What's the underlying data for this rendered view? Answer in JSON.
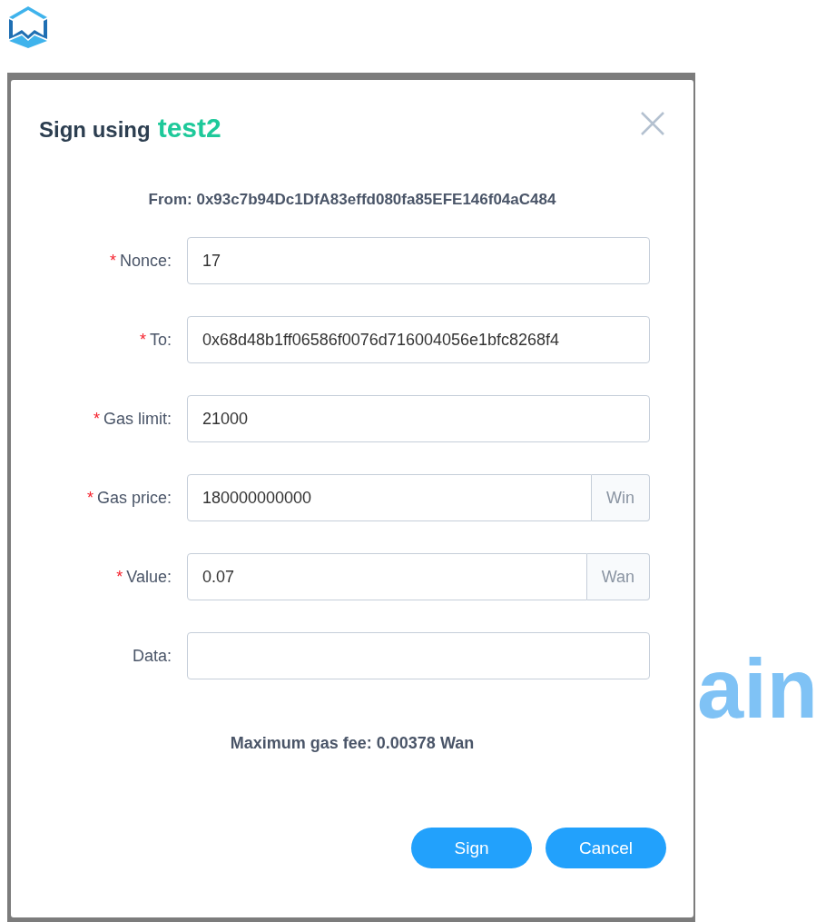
{
  "background_text": "ain",
  "dialog": {
    "title": "Sign using",
    "account": "test2",
    "from": "From: 0x93c7b94Dc1DfA83effd080fa85EFE146f04aC484",
    "required_mark": "*",
    "fields": [
      {
        "label": "Nonce:",
        "required": true,
        "value": "17"
      },
      {
        "label": "To:",
        "required": true,
        "value": "0x68d48b1ff06586f0076d716004056e1bfc8268f4"
      },
      {
        "label": "Gas limit:",
        "required": true,
        "value": "21000"
      },
      {
        "label": "Gas price:",
        "required": true,
        "value": "180000000000",
        "suffix": "Win"
      },
      {
        "label": "Value:",
        "required": true,
        "value": "0.07",
        "suffix": "Wan"
      },
      {
        "label": "Data:",
        "required": false
      }
    ],
    "fee": "Maximum gas fee: 0.00378 Wan",
    "buttons": [
      {
        "label": "Sign"
      },
      {
        "label": "Cancel"
      }
    ]
  }
}
